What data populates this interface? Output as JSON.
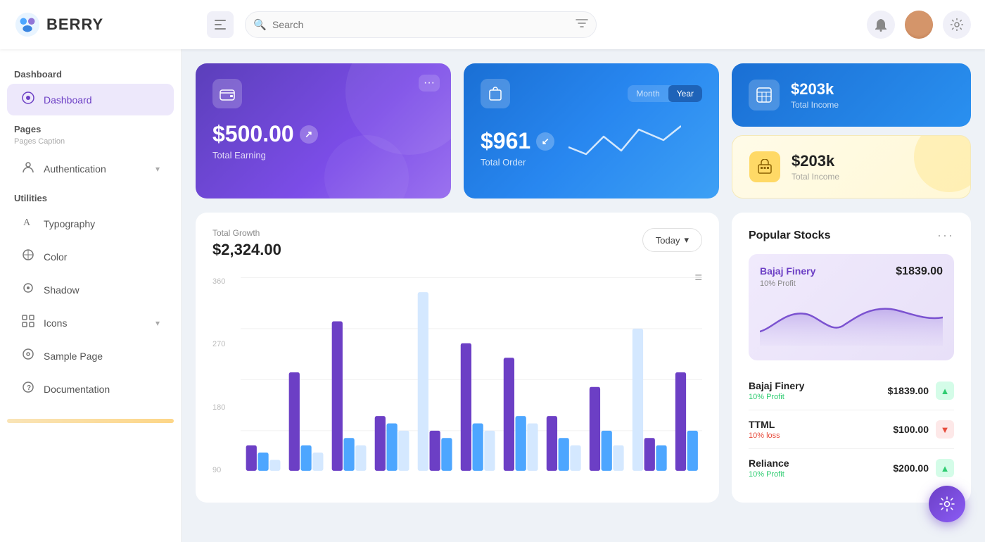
{
  "app": {
    "logo_text": "BERRY",
    "search_placeholder": "Search"
  },
  "header": {
    "hamburger_label": "☰",
    "search_filter_icon": "⚙",
    "bell_icon": "🔔",
    "settings_icon": "⚙"
  },
  "sidebar": {
    "dashboard_section": "Dashboard",
    "dashboard_item": "Dashboard",
    "pages_section": "Pages",
    "pages_caption": "Pages Caption",
    "authentication_item": "Authentication",
    "utilities_section": "Utilities",
    "typography_item": "Typography",
    "color_item": "Color",
    "shadow_item": "Shadow",
    "icons_item": "Icons",
    "sample_page_item": "Sample Page",
    "documentation_item": "Documentation"
  },
  "cards": {
    "total_earning_amount": "$500.00",
    "total_earning_label": "Total Earning",
    "total_order_amount": "$961",
    "total_order_label": "Total Order",
    "month_label": "Month",
    "year_label": "Year",
    "total_income_amount_1": "$203k",
    "total_income_label_1": "Total Income",
    "total_income_amount_2": "$203k",
    "total_income_label_2": "Total Income"
  },
  "chart": {
    "title": "Total Growth",
    "amount": "$2,324.00",
    "filter_label": "Today",
    "y_labels": [
      "360",
      "270",
      "180",
      "90"
    ],
    "menu_icon": "≡"
  },
  "stocks": {
    "section_title": "Popular Stocks",
    "featured_name": "Bajaj Finery",
    "featured_value": "$1839.00",
    "featured_profit": "10% Profit",
    "items": [
      {
        "name": "Bajaj Finery",
        "value": "$1839.00",
        "profit_label": "10% Profit",
        "trend": "up"
      },
      {
        "name": "TTML",
        "value": "$100.00",
        "profit_label": "10% loss",
        "trend": "down"
      },
      {
        "name": "Reliance",
        "value": "$200.00",
        "profit_label": "10% Profit",
        "trend": "up"
      }
    ]
  },
  "fab": {
    "icon": "⚙"
  }
}
